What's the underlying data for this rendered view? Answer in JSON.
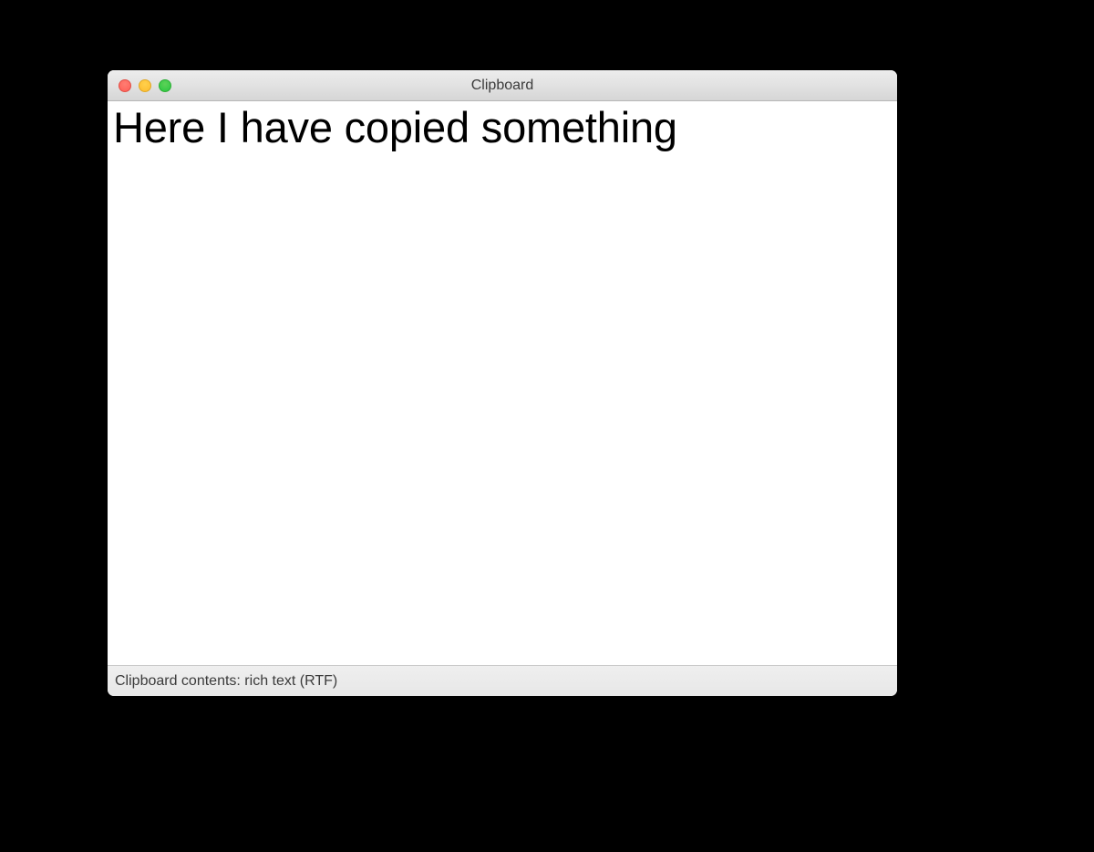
{
  "window": {
    "title": "Clipboard"
  },
  "content": {
    "text": "Here I have copied something"
  },
  "statusbar": {
    "text": "Clipboard contents: rich text (RTF)"
  }
}
